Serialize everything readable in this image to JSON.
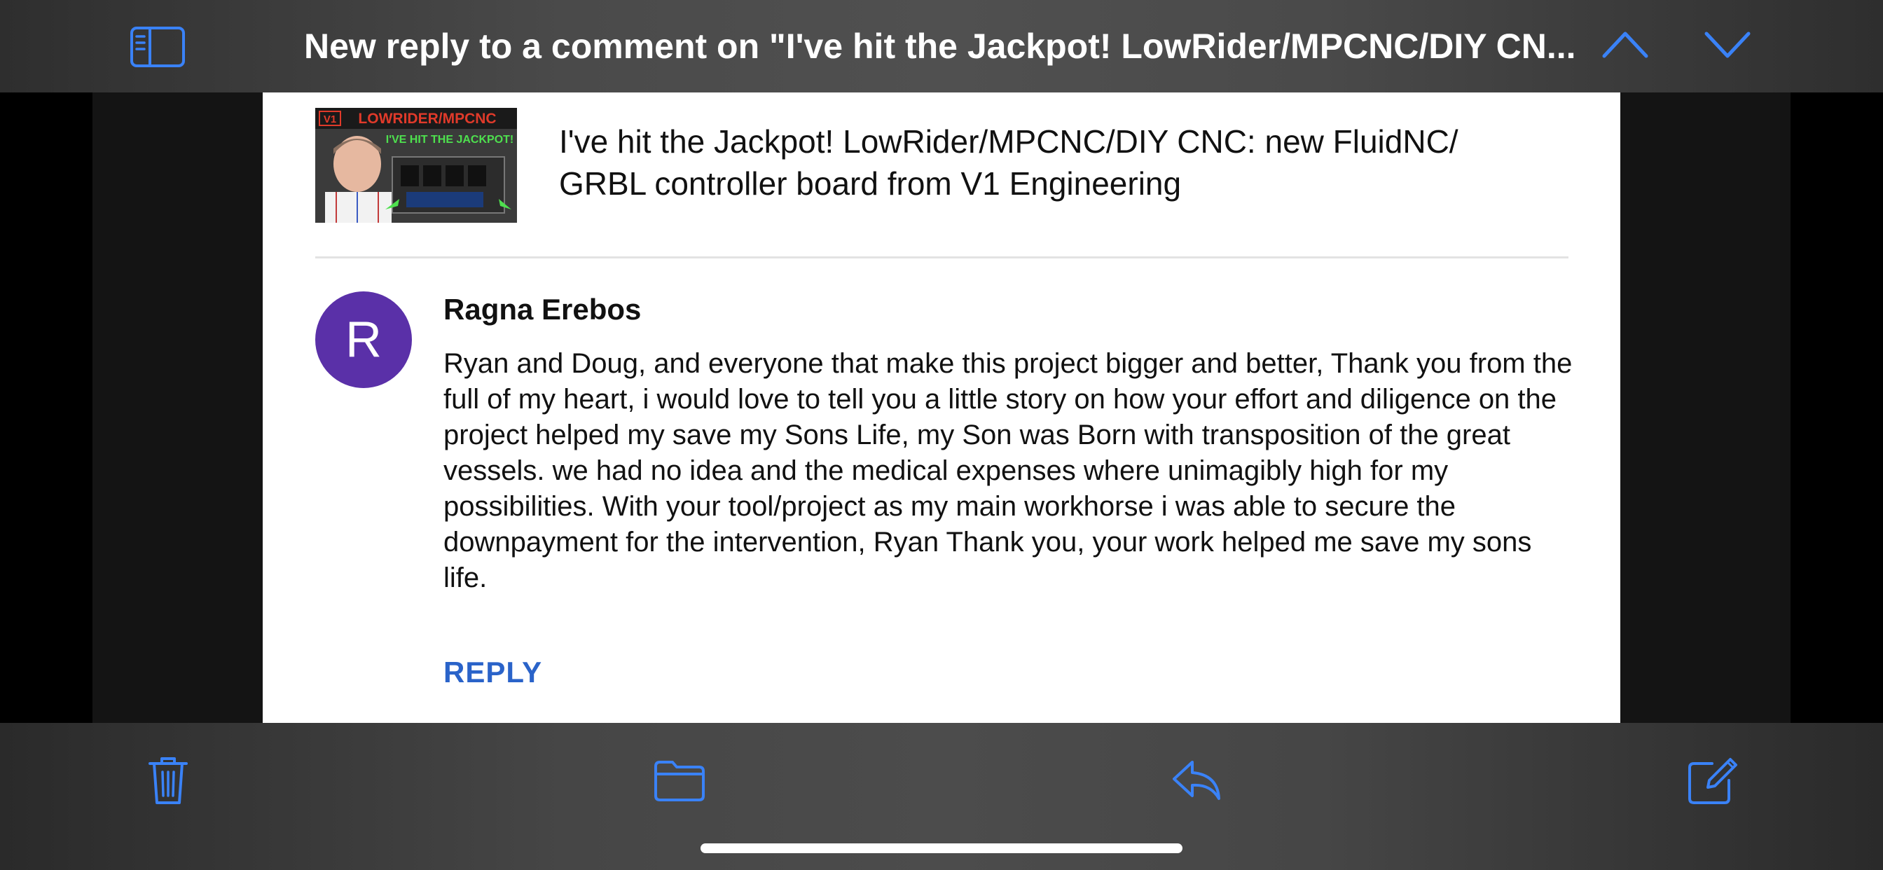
{
  "window": {
    "title": "New reply to a comment on \"I've hit the Jackpot! LowRider/MPCNC/DIY CN..."
  },
  "nav": {
    "sidebar_icon": "sidebar-icon",
    "prev_icon": "chevron-up-icon",
    "next_icon": "chevron-down-icon"
  },
  "video": {
    "title": "I've hit the Jackpot! LowRider/MPCNC/DIY CNC: new FluidNC/ GRBL controller board from V1 Engineering",
    "thumbnail_text_line1": "LOWRIDER/MPCNC",
    "thumbnail_text_line2": "I'VE HIT THE JACKPOT!",
    "thumbnail_logo": "V1"
  },
  "comment": {
    "avatar_letter": "R",
    "author": "Ragna Erebos",
    "body": "Ryan and Doug, and everyone that make this project bigger and better, Thank you from the full of my heart, i would love to tell you a little story on how your effort and diligence on the project helped my save my Sons Life, my Son was Born with transposition of the great vessels. we had no idea and the medical expenses where unimagibly high for my possibilities. With your tool/project as my main workhorse i was able to secure the downpayment for the intervention, Ryan Thank you, your work helped me save my sons life.",
    "reply_label": "REPLY"
  },
  "toolbar": {
    "trash_icon": "trash-icon",
    "folder_icon": "folder-icon",
    "reply_icon": "reply-icon",
    "compose_icon": "compose-icon"
  },
  "colors": {
    "accent": "#3a82f7",
    "link": "#2a63c9",
    "avatar_bg": "#5a30a8"
  }
}
